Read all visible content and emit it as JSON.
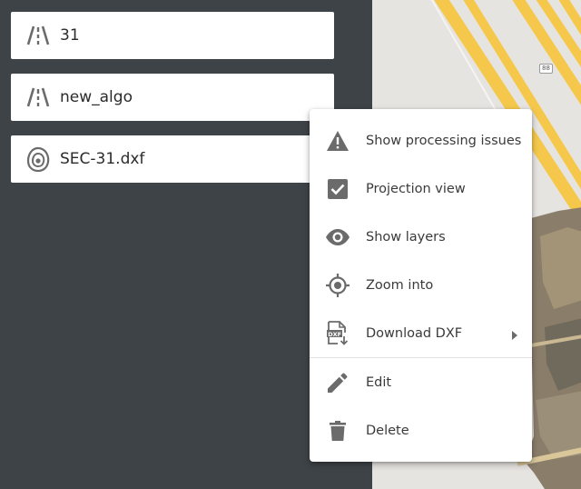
{
  "layers": [
    {
      "label": "31",
      "icon": "road-icon"
    },
    {
      "label": "new_algo",
      "icon": "road-icon"
    },
    {
      "label": "SEC-31.dxf",
      "icon": "contour-icon"
    }
  ],
  "map": {
    "shield_label": "88"
  },
  "context_menu": {
    "items": [
      {
        "label": "Show processing issues",
        "icon": "warning-icon"
      },
      {
        "label": "Projection view",
        "icon": "checkbox-checked-icon"
      },
      {
        "label": "Show layers",
        "icon": "eye-icon"
      },
      {
        "label": "Zoom into",
        "icon": "crosshair-icon"
      },
      {
        "label": "Download DXF",
        "icon": "dxf-download-icon",
        "has_submenu": true
      },
      {
        "label": "Edit",
        "icon": "pencil-icon"
      },
      {
        "label": "Delete",
        "icon": "trash-icon"
      }
    ]
  },
  "colors": {
    "panel_bg": "#3e4347",
    "icon_gray": "#6b6b6b",
    "road_yellow": "#f5c84c"
  }
}
